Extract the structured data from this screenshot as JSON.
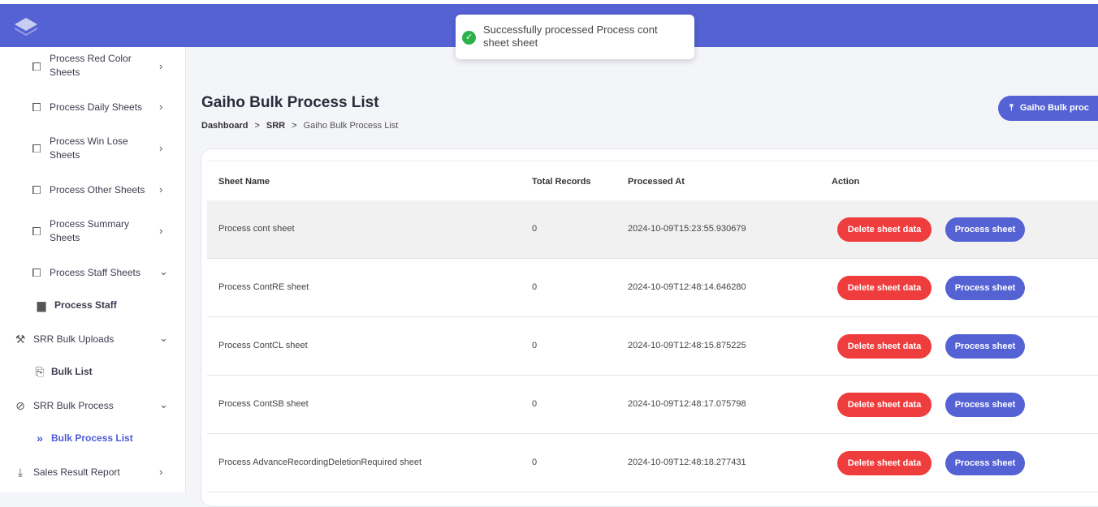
{
  "toast": {
    "message": "Successfully processed Process cont sheet sheet"
  },
  "sidebar": {
    "items": [
      {
        "label": "Process Red Color Sheets",
        "icon": "sheet-icon",
        "chevron": ">"
      },
      {
        "label": "Process Daily Sheets",
        "icon": "sheet-icon",
        "chevron": ">"
      },
      {
        "label": "Process Win Lose Sheets",
        "icon": "sheet-icon",
        "chevron": ">"
      },
      {
        "label": "Process Other Sheets",
        "icon": "sheet-icon",
        "chevron": ">"
      },
      {
        "label": "Process Summary Sheets",
        "icon": "sheet-icon",
        "chevron": ">"
      },
      {
        "label": "Process Staff Sheets",
        "icon": "sheet-icon",
        "chevron": "v"
      },
      {
        "label": "Process Staff",
        "icon": "file-icon"
      },
      {
        "label": "SRR Bulk Uploads",
        "icon": "gavel-icon",
        "chevron": "v"
      },
      {
        "label": "Bulk List",
        "icon": "upload-file-icon"
      },
      {
        "label": "SRR Bulk Process",
        "icon": "process-icon",
        "chevron": "v"
      },
      {
        "label": "Bulk Process List",
        "icon": "double-chevron-icon"
      },
      {
        "label": "Sales Result Report",
        "icon": "download-icon",
        "chevron": ">"
      }
    ]
  },
  "page": {
    "title": "Gaiho Bulk Process List",
    "breadcrumb": [
      "Dashboard",
      "SRR",
      "Gaiho Bulk Process List"
    ],
    "upload_button": "Gaiho Bulk proc"
  },
  "table": {
    "headers": [
      "Sheet Name",
      "Total Records",
      "Processed At",
      "Action"
    ],
    "rows": [
      {
        "name": "Process cont sheet",
        "total": "0",
        "processed_at": "2024-10-09T15:23:55.930679"
      },
      {
        "name": "Process ContRE sheet",
        "total": "0",
        "processed_at": "2024-10-09T12:48:14.646280"
      },
      {
        "name": "Process ContCL sheet",
        "total": "0",
        "processed_at": "2024-10-09T12:48:15.875225"
      },
      {
        "name": "Process ContSB sheet",
        "total": "0",
        "processed_at": "2024-10-09T12:48:17.075798"
      },
      {
        "name": "Process AdvanceRecordingDeletionRequired sheet",
        "total": "0",
        "processed_at": "2024-10-09T12:48:18.277431"
      }
    ],
    "delete_label": "Delete sheet data",
    "process_label": "Process sheet"
  },
  "colors": {
    "primary": "#5462d4",
    "danger": "#ef3c3c",
    "success": "#2bb24c"
  }
}
